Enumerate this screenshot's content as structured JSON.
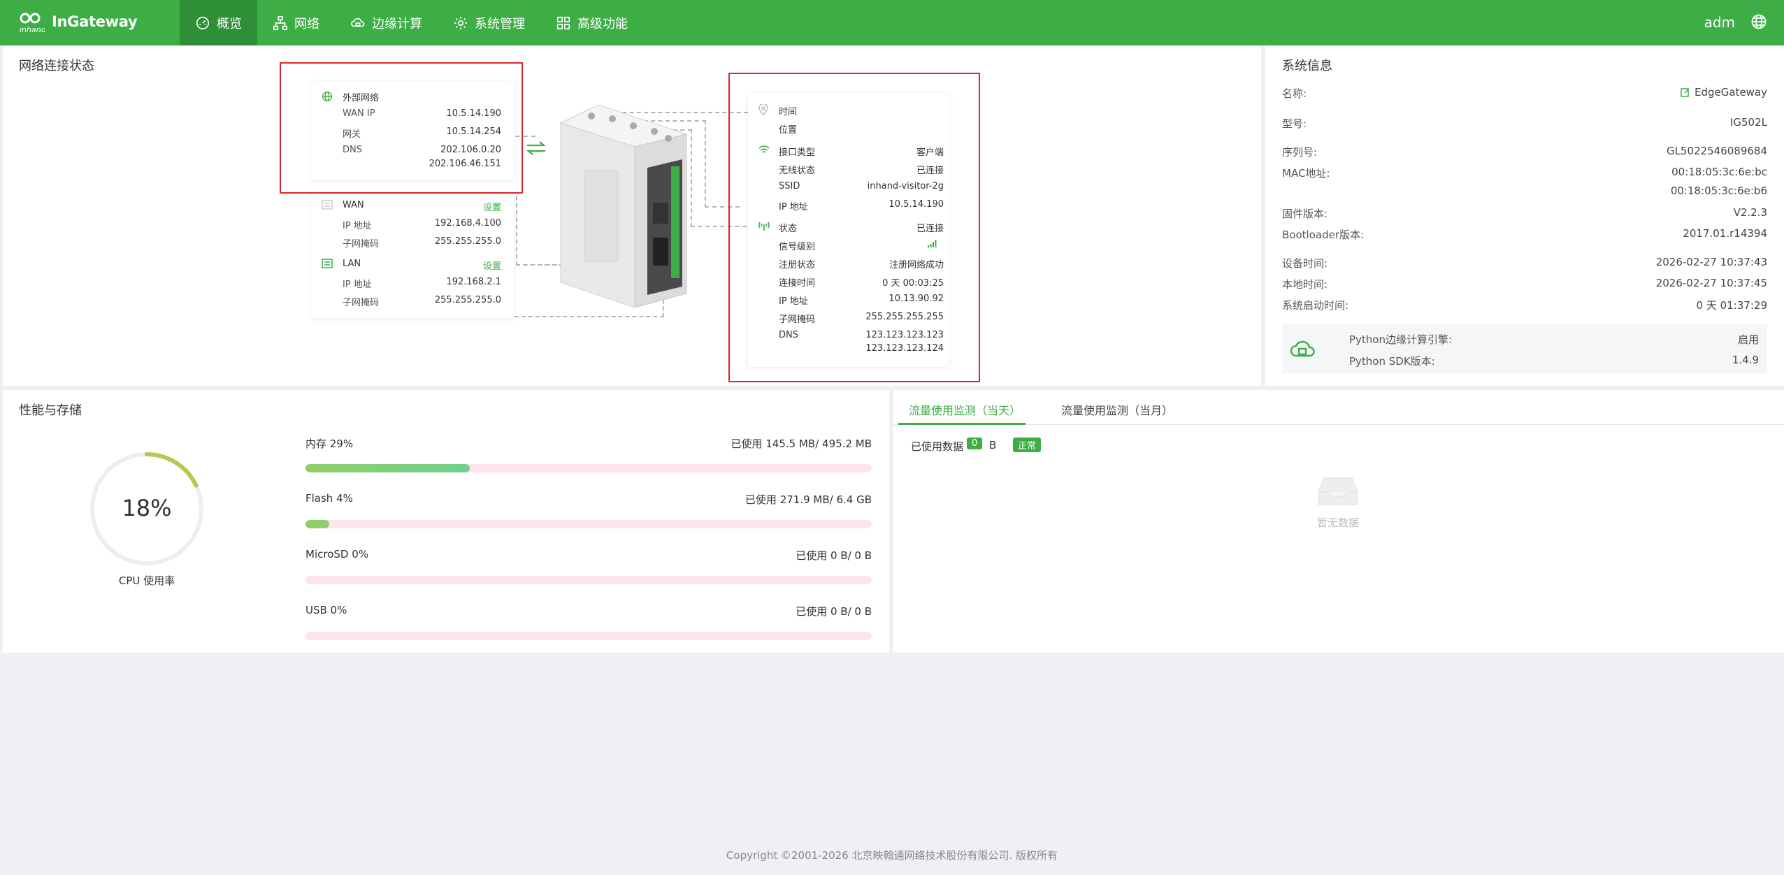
{
  "header": {
    "logo_mark": "inhand",
    "app_name": "InGateway",
    "user": "adm",
    "menu": [
      {
        "label": "概览",
        "icon": "dashboard-icon"
      },
      {
        "label": "网络",
        "icon": "network-icon"
      },
      {
        "label": "边缘计算",
        "icon": "edge-cloud-icon"
      },
      {
        "label": "系统管理",
        "icon": "gear-icon"
      },
      {
        "label": "高级功能",
        "icon": "grid-icon"
      }
    ]
  },
  "network": {
    "title": "网络连接状态",
    "external": {
      "title": "外部网络",
      "wan_ip_label": "WAN IP",
      "wan_ip": "10.5.14.190",
      "gateway_label": "网关",
      "gateway": "10.5.14.254",
      "dns_label": "DNS",
      "dns1": "202.106.0.20",
      "dns2": "202.106.46.151"
    },
    "wan": {
      "title": "WAN",
      "action": "设置",
      "ip_label": "IP 地址",
      "ip": "192.168.4.100",
      "mask_label": "子网掩码",
      "mask": "255.255.255.0"
    },
    "lan": {
      "title": "LAN",
      "action": "设置",
      "ip_label": "IP 地址",
      "ip": "192.168.2.1",
      "mask_label": "子网掩码",
      "mask": "255.255.255.0"
    },
    "location": {
      "time_label": "时间",
      "pos_label": "位置"
    },
    "wifi": {
      "type_label": "接口类型",
      "type": "客户端",
      "state_label": "无线状态",
      "state": "已连接",
      "ssid_label": "SSID",
      "ssid": "inhand-visitor-2g",
      "ip_label": "IP 地址",
      "ip": "10.5.14.190"
    },
    "cellular": {
      "status_label": "状态",
      "status": "已连接",
      "signal_label": "信号级别",
      "reg_label": "注册状态",
      "reg": "注册网络成功",
      "conn_label": "连接时间",
      "conn": "0 天 00:03:25",
      "ip_label": "IP 地址",
      "ip": "10.13.90.92",
      "mask_label": "子网掩码",
      "mask": "255.255.255.255",
      "dns_label": "DNS",
      "dns1": "123.123.123.123",
      "dns2": "123.123.123.124"
    }
  },
  "system": {
    "title": "系统信息",
    "name_label": "名称:",
    "name": "EdgeGateway",
    "model_label": "型号:",
    "model": "IG502L",
    "serial_label": "序列号:",
    "serial": "GL5022546089684",
    "mac_label": "MAC地址:",
    "mac1": "00:18:05:3c:6e:bc",
    "mac2": "00:18:05:3c:6e:b6",
    "fw_label": "固件版本:",
    "fw": "V2.2.3",
    "boot_label": "Bootloader版本:",
    "boot": "2017.01.r14394",
    "dev_time_label": "设备时间:",
    "dev_time": "2026-02-27 10:37:43",
    "local_time_label": "本地时间:",
    "local_time": "2026-02-27 10:37:45",
    "uptime_label": "系统启动时间:",
    "uptime": "0 天 01:37:29",
    "py_engine_label": "Python边缘计算引擎:",
    "py_engine": "启用",
    "py_sdk_label": "Python SDK版本:",
    "py_sdk": "1.4.9"
  },
  "perf": {
    "title": "性能与存储",
    "cpu": {
      "value": "18%",
      "percent": 18,
      "label": "CPU 使用率"
    },
    "storage": [
      {
        "label": "内存 29%",
        "used": "已使用 145.5 MB/ 495.2 MB",
        "percent": 29
      },
      {
        "label": "Flash 4%",
        "used": "已使用 271.9 MB/ 6.4 GB",
        "percent": 4
      },
      {
        "label": "MicroSD 0%",
        "used": "已使用 0 B/ 0 B",
        "percent": 0
      },
      {
        "label": "USB 0%",
        "used": "已使用 0 B/ 0 B",
        "percent": 0
      }
    ]
  },
  "traffic": {
    "tab_day": "流量使用监测（当天）",
    "tab_month": "流量使用监测（当月）",
    "used_label": "已使用数据",
    "used_value": "0",
    "used_unit": "B",
    "status": "正常",
    "empty": "暂无数据"
  },
  "footer": {
    "text": "Copyright ©2001-2026 北京映翰通网络技术股份有限公司. 版权所有"
  },
  "colors": {
    "primary": "#3cae45",
    "active": "#2e8f36",
    "highlight": "#e0262c"
  }
}
